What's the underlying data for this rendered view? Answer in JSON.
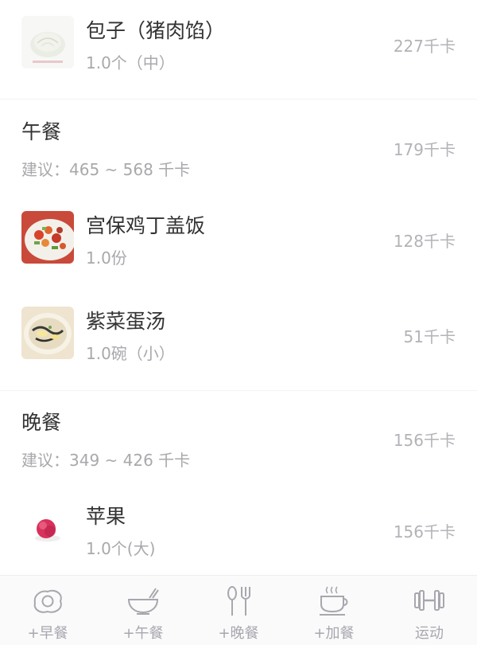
{
  "breakfast_items": [
    {
      "name": "包子（猪肉馅）",
      "quantity": "1.0个（中）",
      "calories": "227千卡",
      "image": "steamed-bun-photo"
    }
  ],
  "lunch": {
    "title": "午餐",
    "suggestion": "建议：465 ~ 568 千卡",
    "calories": "179千卡",
    "items": [
      {
        "name": "宫保鸡丁盖饭",
        "quantity": "1.0份",
        "calories": "128千卡",
        "image": "kung-pao-chicken-rice-photo"
      },
      {
        "name": "紫菜蛋汤",
        "quantity": "1.0碗（小）",
        "calories": "51千卡",
        "image": "seaweed-egg-soup-photo"
      }
    ]
  },
  "dinner": {
    "title": "晚餐",
    "suggestion": "建议：349 ~ 426 千卡",
    "calories": "156千卡",
    "items": [
      {
        "name": "苹果",
        "quantity": "1.0个(大)",
        "calories": "156千卡",
        "image": "apple-photo"
      }
    ]
  },
  "tabbar": {
    "items": [
      {
        "label": "+早餐",
        "icon": "fried-egg-icon"
      },
      {
        "label": "+午餐",
        "icon": "bowl-icon"
      },
      {
        "label": "+晚餐",
        "icon": "spoon-fork-icon"
      },
      {
        "label": "+加餐",
        "icon": "coffee-cup-icon"
      },
      {
        "label": "运动",
        "icon": "dumbbell-icon"
      }
    ]
  },
  "colors": {
    "text": "#333333",
    "muted": "#a9a9ad",
    "tab": "#a7a7ae",
    "divider": "#f3f3f5"
  }
}
